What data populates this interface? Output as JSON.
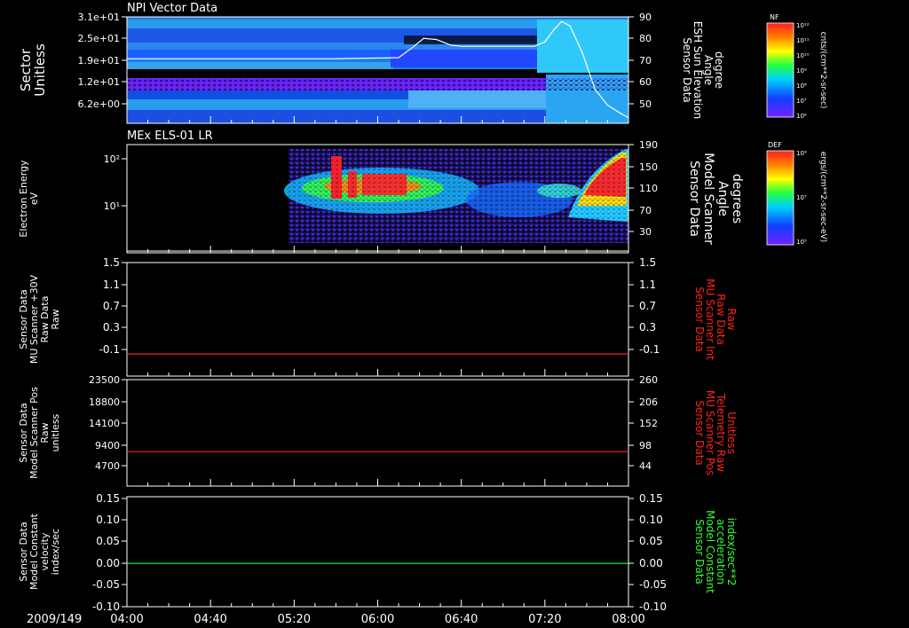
{
  "date_label": "2009/149",
  "time_ticks": [
    "04:00",
    "04:40",
    "05:20",
    "06:00",
    "06:40",
    "07:20",
    "08:00"
  ],
  "colors": {
    "white": "#ffffff",
    "red": "#ff2020",
    "green": "#30ff30",
    "frame": "#ffffff"
  },
  "chart_data": [
    {
      "type": "heatmap",
      "title": "NPI Vector Data",
      "ylabel_left": [
        "Sector",
        "Unitless"
      ],
      "left_ticks": [
        "3.1e+01",
        "2.5e+01",
        "1.9e+01",
        "1.2e+01",
        "6.2e+00"
      ],
      "ylabel_right": [
        "Sensor Data",
        "ESH Sun Elevation",
        "Angle",
        "degree"
      ],
      "right_ticks": [
        "90",
        "80",
        "70",
        "60",
        "50"
      ],
      "right_ylim": [
        43,
        90
      ],
      "colorbar": {
        "tag": "NF",
        "ticks": [
          "10¹²",
          "10¹¹",
          "10¹⁰",
          "10⁹",
          "10⁸",
          "10⁷",
          "10⁶"
        ],
        "unit": "cnts/(cm**2-sr-sec)"
      },
      "overlay_series": {
        "name": "ESH Sun Elevation Angle",
        "x_minutes": [
          0,
          100,
          130,
          136,
          142,
          148,
          155,
          160,
          175,
          195,
          200,
          204,
          208,
          212,
          218,
          224,
          230,
          236,
          240
        ],
        "values": [
          71.5,
          71.5,
          72,
          76,
          80.5,
          80,
          77.5,
          77,
          77,
          77,
          79,
          84,
          88,
          86,
          74,
          58,
          51,
          47.5,
          45.5
        ]
      }
    },
    {
      "type": "heatmap",
      "title": "MEx ELS-01 LR",
      "ylabel_left": [
        "Electron Energy",
        "eV"
      ],
      "left_ticks": [
        "10²",
        "10¹"
      ],
      "ylabel_right": [
        "Sensor Data",
        "Model Scanner",
        "Angle",
        "degrees"
      ],
      "right_ticks": [
        "190",
        "150",
        "110",
        "70",
        "30"
      ],
      "right_ylim": [
        5,
        190
      ],
      "colorbar": {
        "tag": "DEF",
        "ticks": [
          "10⁹",
          "10⁷",
          "10⁵"
        ],
        "unit": "ergs/(cm**2-sr-sec-eV)"
      },
      "overlay_series": {
        "name": "Model Scanner Angle",
        "x_minutes": [
          0,
          240
        ],
        "values": [
          8,
          8
        ]
      }
    },
    {
      "type": "line",
      "ylabel_left": [
        "Sensor Data",
        "MU Scanner +30V",
        "Raw Data",
        "Raw"
      ],
      "left_ticks": [
        "1.5",
        "1.1",
        "0.7",
        "0.3",
        "-0.1"
      ],
      "left_ylim": [
        -0.3,
        1.5
      ],
      "ylabel_right": [
        "Sensor Data",
        "MU Scanner Int",
        "Raw Data",
        "Raw"
      ],
      "right_ticks": [
        "1.5",
        "1.1",
        "0.7",
        "0.3",
        "-0.1"
      ],
      "series": [
        {
          "x_minutes": [
            0,
            240
          ],
          "values": [
            0.05,
            0.05
          ]
        }
      ]
    },
    {
      "type": "line",
      "ylabel_left": [
        "Sensor Data",
        "Model Scanner Pos",
        "Raw",
        "unitless"
      ],
      "left_ticks": [
        "23500",
        "18800",
        "14100",
        "9400",
        "4700"
      ],
      "left_ylim": [
        0,
        23500
      ],
      "ylabel_right": [
        "Sensor Data",
        "MU Scanner Pos",
        "Telemetry Raw",
        "Unitless"
      ],
      "right_ticks": [
        "260",
        "206",
        "152",
        "98",
        "44"
      ],
      "series": [
        {
          "x_minutes": [
            0,
            240
          ],
          "values": [
            7600,
            7600
          ]
        }
      ]
    },
    {
      "type": "line",
      "ylabel_left": [
        "Sensor Data",
        "Model Constant",
        "velocity",
        "index/sec"
      ],
      "left_ticks": [
        "0.15",
        "0.10",
        "0.05",
        "0.00",
        "-0.05",
        "-0.10"
      ],
      "left_ylim": [
        -0.1,
        0.15
      ],
      "ylabel_right": [
        "Sensor Data",
        "Model Constant",
        "acceleration",
        "index/sec**2"
      ],
      "right_ticks": [
        "0.15",
        "0.10",
        "0.05",
        "0.00",
        "-0.05",
        "-0.10"
      ],
      "series": [
        {
          "x_minutes": [
            0,
            240
          ],
          "values": [
            0.0,
            0.0
          ]
        }
      ]
    }
  ]
}
